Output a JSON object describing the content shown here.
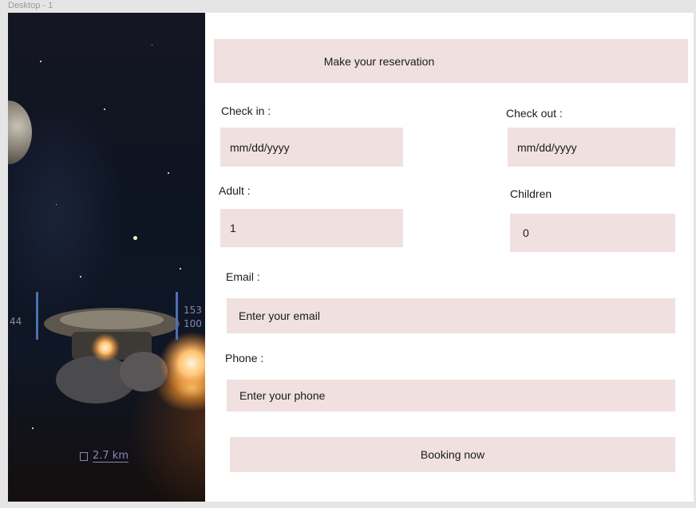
{
  "frame": {
    "title": "Desktop - 1"
  },
  "hero": {
    "distance_label": "2.7 km",
    "hud_left": "44",
    "hud_right_top": "153",
    "hud_right_bottom": "100"
  },
  "form": {
    "heading": "Make your reservation",
    "check_in": {
      "label": "Check in :",
      "placeholder": "mm/dd/yyyy"
    },
    "check_out": {
      "label": "Check out :",
      "placeholder": "mm/dd/yyyy"
    },
    "adult": {
      "label": "Adult :",
      "value": "1"
    },
    "children": {
      "label": "Children",
      "value": "0"
    },
    "email": {
      "label": "Email :",
      "placeholder": "Enter your email"
    },
    "phone": {
      "label": "Phone :",
      "placeholder": "Enter your phone"
    },
    "submit_label": "Booking now"
  },
  "colors": {
    "field_bg": "#f0e0e0",
    "canvas_bg": "#e5e5e5",
    "panel_bg": "#ffffff"
  }
}
